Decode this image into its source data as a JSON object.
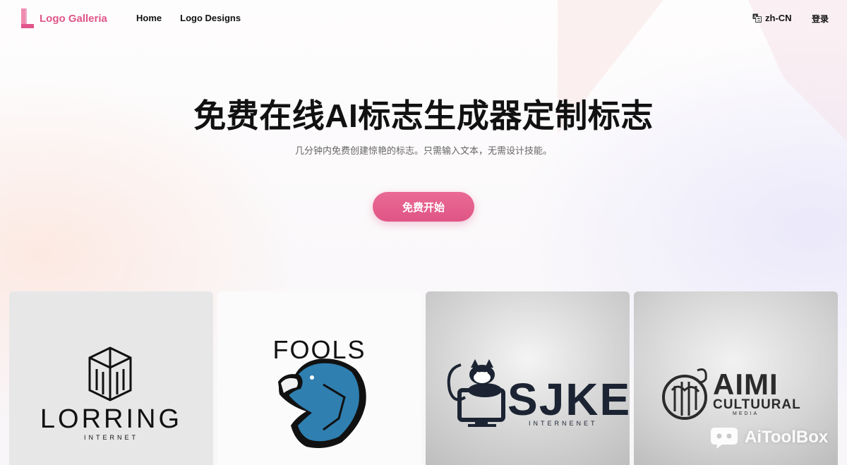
{
  "header": {
    "brand": "Logo Galleria",
    "nav": [
      {
        "label": "Home"
      },
      {
        "label": "Logo Designs"
      }
    ],
    "language": "zh-CN",
    "login": "登录"
  },
  "hero": {
    "title": "免费在线AI标志生成器定制标志",
    "subtitle": "几分钟内免费创建惊艳的标志。只需输入文本，无需设计技能。",
    "cta": "免费开始"
  },
  "gallery": {
    "items": [
      {
        "name": "LORRING",
        "tagline": "INTERNET"
      },
      {
        "name": "FOOLS"
      },
      {
        "name": "SJKE",
        "tagline": "INTERNENET"
      },
      {
        "name": "AIMI",
        "line2": "CULTUURAL",
        "tagline": "MEDIA"
      }
    ]
  },
  "watermark": {
    "text": "AiToolBox"
  },
  "colors": {
    "brand": "#e0558a",
    "cta": "#df5585",
    "eagle": "#2f7fb0"
  }
}
